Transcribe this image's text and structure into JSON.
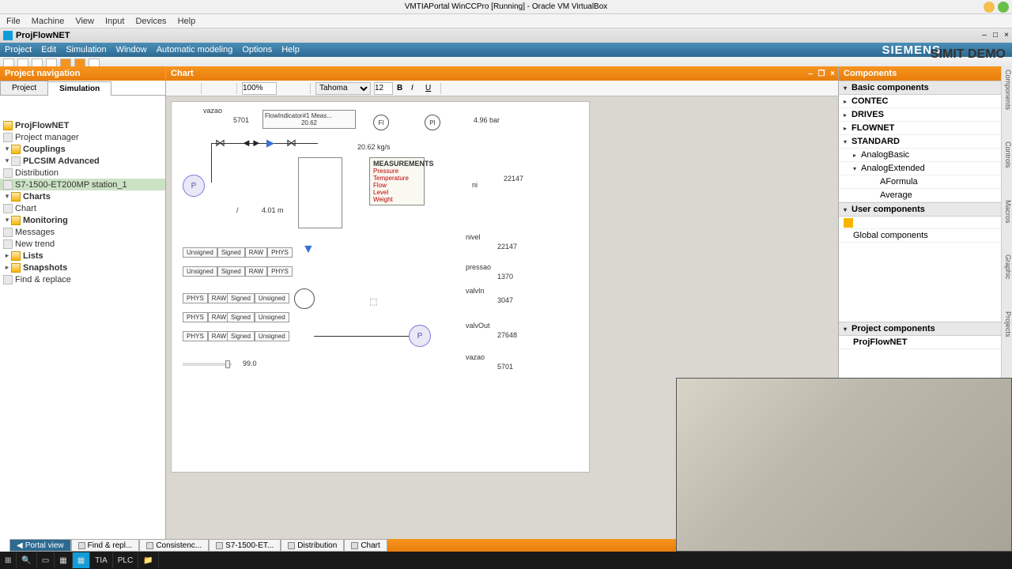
{
  "virtualbox": {
    "title": "VMTIAPortal WinCCPro [Running] - Oracle VM VirtualBox",
    "menu": [
      "File",
      "Machine",
      "View",
      "Input",
      "Devices",
      "Help"
    ]
  },
  "app": {
    "title": "ProjFlowNET",
    "menu": [
      "Project",
      "Edit",
      "Simulation",
      "Window",
      "Automatic modeling",
      "Options",
      "Help"
    ],
    "brand": "SIEMENS",
    "edition": "SIMIT DEMO"
  },
  "left": {
    "header": "Project navigation",
    "tabs": {
      "project": "Project",
      "simulation": "Simulation"
    },
    "tree": {
      "root": "ProjFlowNET",
      "projectManager": "Project manager",
      "couplings": "Couplings",
      "plcsim": "PLCSIM Advanced",
      "distribution": "Distribution",
      "station": "S7-1500-ET200MP station_1",
      "charts": "Charts",
      "chart": "Chart",
      "monitoring": "Monitoring",
      "messages": "Messages",
      "newTrend": "New trend",
      "lists": "Lists",
      "snapshots": "Snapshots",
      "findReplace": "Find & replace"
    }
  },
  "chart": {
    "header": "Chart",
    "zoom": "100%",
    "font": "Tahoma",
    "fontSize": "12",
    "bottomTab": "Chart",
    "vazao_label": "vazao",
    "vazao_val": "5701",
    "flowInd_label": "FlowIndicator#1 Meas...",
    "flowInd_val": "20.62",
    "fi_lbl": "FI",
    "pi_lbl": "PI",
    "pres_val": "4.96",
    "pres_unit": "bar",
    "flow_rate": "20.62",
    "flow_unit": "kg/s",
    "level_val": "4.01",
    "level_unit": "m",
    "measurements_hd": "MEASUREMENTS",
    "meas_items": [
      "Pressure",
      "Temperature",
      "Flow",
      "Level",
      "Weight"
    ],
    "ni_label": "ni",
    "ni_val": "22147",
    "sig_unsigned": "Unsigned",
    "sig_signed": "Signed",
    "sig_raw": "RAW",
    "sig_phys": "PHYS",
    "slider_val": "99.0",
    "tags": {
      "nivel": {
        "label": "nivel",
        "val": "22147"
      },
      "pressao": {
        "label": "pressao",
        "val": "1370"
      },
      "valvIn": {
        "label": "valvIn",
        "val": "3047"
      },
      "valvOut": {
        "label": "valvOut",
        "val": "27648"
      },
      "vazao": {
        "label": "vazao",
        "val": "5701"
      }
    }
  },
  "right": {
    "header": "Components",
    "basic": "Basic components",
    "libs": [
      "CONTEC",
      "DRIVES",
      "FLOWNET",
      "STANDARD"
    ],
    "analogBasic": "AnalogBasic",
    "analogExtended": "AnalogExtended",
    "aformula": "AFormula",
    "average": "Average",
    "userComp": "User components",
    "globalComp": "Global components",
    "projComp": "Project components",
    "projName": "ProjFlowNET",
    "vtabs": [
      "Components",
      "Controls",
      "Macros",
      "Graphic",
      "Projects"
    ]
  },
  "status": {
    "portal": "Portal view",
    "tabs": [
      "Find & repl...",
      "Consistenc...",
      "S7-1500-ET...",
      "Distribution",
      "Chart"
    ]
  }
}
